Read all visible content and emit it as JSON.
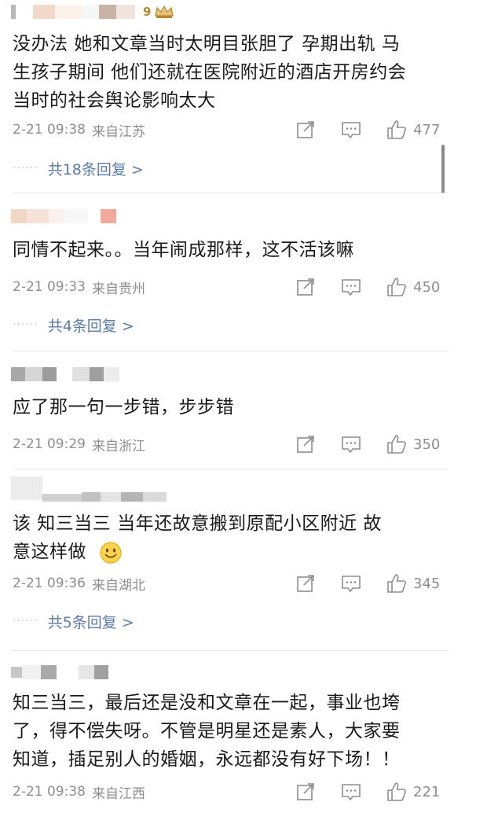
{
  "comments": [
    {
      "badge": "9",
      "content_lines": [
        "没办法 她和文章当时太明目张胆了 孕期出轨 马",
        "生孩子期间 他们还就在医院附近的酒店开房约会",
        "当时的社会舆论影响太大"
      ],
      "time": "2-21 09:38",
      "location": "来自江苏",
      "likes": "477",
      "replies": "共18条回复 >"
    },
    {
      "content_lines": [
        "同情不起来。。当年闹成那样，这不活该嘛"
      ],
      "time": "2-21 09:33",
      "location": "来自贵州",
      "likes": "450",
      "replies": "共4条回复 >"
    },
    {
      "content_lines": [
        "应了那一句一步错，步步错"
      ],
      "time": "2-21 09:29",
      "location": "来自浙江",
      "likes": "350"
    },
    {
      "content_lines": [
        "该  知三当三  当年还故意搬到原配小区附近  故",
        "意这样做"
      ],
      "time": "2-21 09:36",
      "location": "来自湖北",
      "likes": "345",
      "replies": "共5条回复 >"
    },
    {
      "content_lines": [
        "知三当三，最后还是没和文章在一起，事业也垮",
        "了，得不偿失呀。不管是明星还是素人，大家要",
        "知道，插足别人的婚姻，永远都没有好下场！！"
      ],
      "time": "2-21 09:38",
      "location": "来自江西",
      "likes": "221"
    }
  ],
  "icons": {
    "share": "share-icon",
    "reply": "comment-icon",
    "like": "thumbs-up-icon",
    "crown": "crown-icon",
    "emoji": "smile-emoji-icon"
  },
  "colors": {
    "link": "#5a7ba6",
    "meta": "#8e8e8e",
    "badge": "#b8872c"
  }
}
